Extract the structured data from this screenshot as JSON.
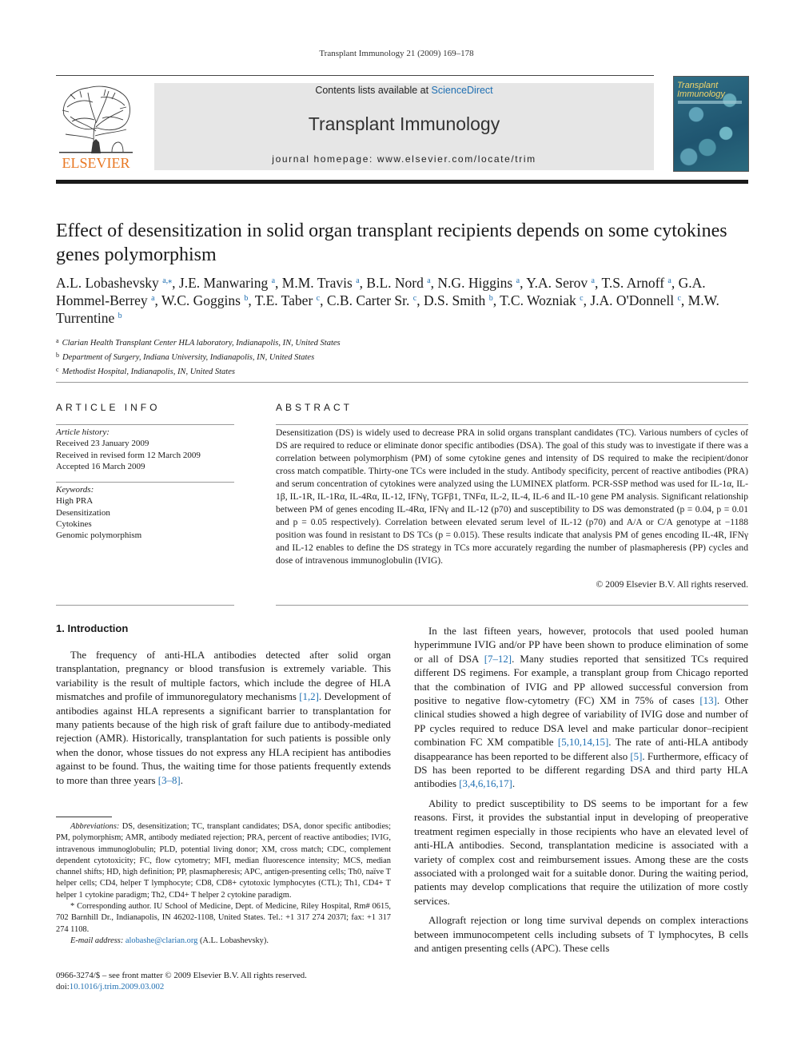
{
  "running_head": "Transplant Immunology 21 (2009) 169–178",
  "masthead": {
    "contents_prefix": "Contents lists available at ",
    "contents_link": "ScienceDirect",
    "journal_title": "Transplant Immunology",
    "homepage": "journal homepage: www.elsevier.com/locate/trim",
    "publisher_logo_text": "ELSEVIER",
    "cover_title": "Transplant Immunology",
    "brand_color": "#e87722",
    "link_color": "#1f6fb2"
  },
  "article": {
    "title": "Effect of desensitization in solid organ transplant recipients depends on some cytokines genes polymorphism",
    "authors": [
      {
        "name": "A.L. Lobashevsky",
        "aff": "a,⁎"
      },
      {
        "name": "J.E. Manwaring",
        "aff": "a"
      },
      {
        "name": "M.M. Travis",
        "aff": "a"
      },
      {
        "name": "B.L. Nord",
        "aff": "a"
      },
      {
        "name": "N.G. Higgins",
        "aff": "a"
      },
      {
        "name": "Y.A. Serov",
        "aff": "a"
      },
      {
        "name": "T.S. Arnoff",
        "aff": "a"
      },
      {
        "name": "G.A. Hommel-Berrey",
        "aff": "a"
      },
      {
        "name": "W.C. Goggins",
        "aff": "b"
      },
      {
        "name": "T.E. Taber",
        "aff": "c"
      },
      {
        "name": "C.B. Carter Sr.",
        "aff": "c"
      },
      {
        "name": "D.S. Smith",
        "aff": "b"
      },
      {
        "name": "T.C. Wozniak",
        "aff": "c"
      },
      {
        "name": "J.A. O'Donnell",
        "aff": "c"
      },
      {
        "name": "M.W. Turrentine",
        "aff": "b"
      }
    ],
    "affiliations": [
      {
        "label": "a",
        "text": "Clarian Health Transplant Center HLA laboratory, Indianapolis, IN, United States"
      },
      {
        "label": "b",
        "text": "Department of Surgery, Indiana University, Indianapolis, IN, United States"
      },
      {
        "label": "c",
        "text": "Methodist Hospital, Indianapolis, IN, United States"
      }
    ]
  },
  "article_info": {
    "heading": "ARTICLE INFO",
    "history_label": "Article history:",
    "history": [
      "Received 23 January 2009",
      "Received in revised form 12 March 2009",
      "Accepted 16 March 2009"
    ],
    "keywords_label": "Keywords:",
    "keywords": [
      "High PRA",
      "Desensitization",
      "Cytokines",
      "Genomic polymorphism"
    ]
  },
  "abstract": {
    "heading": "ABSTRACT",
    "text": "Desensitization (DS) is widely used to decrease PRA in solid organs transplant candidates (TC). Various numbers of cycles of DS are required to reduce or eliminate donor specific antibodies (DSA). The goal of this study was to investigate if there was a correlation between polymorphism (PM) of some cytokine genes and intensity of DS required to make the recipient/donor cross match compatible. Thirty-one TCs were included in the study. Antibody specificity, percent of reactive antibodies (PRA) and serum concentration of cytokines were analyzed using the LUMINEX platform. PCR-SSP method was used for IL-1α, IL-1β, IL-1R, IL-1Rα, IL-4Rα, IL-12, IFNγ, TGFβ1, TNFα, IL-2, IL-4, IL-6 and IL-10 gene PM analysis. Significant relationship between PM of genes encoding IL-4Rα, IFNγ and IL-12 (p70) and susceptibility to DS was demonstrated (p = 0.04, p = 0.01 and p = 0.05 respectively). Correlation between elevated serum level of IL-12 (p70) and A/A or C/A genotype at −1188 position was found in resistant to DS TCs (p = 0.015). These results indicate that analysis PM of genes encoding IL-4R, IFNγ and IL-12 enables to define the DS strategy in TCs more accurately regarding the number of plasmapheresis (PP) cycles and dose of intravenous immunoglobulin (IVIG).",
    "copyright": "© 2009 Elsevier B.V. All rights reserved."
  },
  "introduction": {
    "heading": "1. Introduction",
    "col1_paragraphs": [
      [
        {
          "t": "The frequency of anti-HLA antibodies detected after solid organ transplantation, pregnancy or blood transfusion is extremely variable. This variability is the result of multiple factors, which include the degree of HLA mismatches and profile of immunoregulatory mechanisms "
        },
        {
          "r": "[1,2]"
        },
        {
          "t": ". Development of antibodies against HLA represents a significant barrier to transplantation for many patients because of the high risk of graft failure due to antibody-mediated rejection (AMR). Historically, transplantation for such patients is possible only when the donor, whose tissues do not express any HLA recipient has antibodies against to be found. Thus, the waiting time for those patients frequently extends to more than three years "
        },
        {
          "r": "[3–8]"
        },
        {
          "t": "."
        }
      ]
    ],
    "col2_paragraphs": [
      [
        {
          "t": "In the last fifteen years, however, protocols that used pooled human hyperimmune IVIG and/or PP have been shown to produce elimination of some or all of DSA "
        },
        {
          "r": "[7–12]"
        },
        {
          "t": ". Many studies reported that sensitized TCs required different DS regimens. For example, a transplant group from Chicago reported that the combination of IVIG and PP allowed successful conversion from positive to negative flow-cytometry (FC) XM in 75% of cases "
        },
        {
          "r": "[13]"
        },
        {
          "t": ". Other clinical studies showed a high degree of variability of IVIG dose and number of PP cycles required to reduce DSA level and make particular donor–recipient combination FC XM compatible "
        },
        {
          "r": "[5,10,14,15]"
        },
        {
          "t": ". The rate of anti-HLA antibody disappearance has been reported to be different also "
        },
        {
          "r": "[5]"
        },
        {
          "t": ". Furthermore, efficacy of DS has been reported to be different regarding DSA and third party HLA antibodies "
        },
        {
          "r": "[3,4,6,16,17]"
        },
        {
          "t": "."
        }
      ],
      [
        {
          "t": "Ability to predict susceptibility to DS seems to be important for a few reasons. First, it provides the substantial input in developing of preoperative treatment regimen especially in those recipients who have an elevated level of anti-HLA antibodies. Second, transplantation medicine is associated with a variety of complex cost and reimbursement issues. Among these are the costs associated with a prolonged wait for a suitable donor. During the waiting period, patients may develop complications that require the utilization of more costly services."
        }
      ],
      [
        {
          "t": "Allograft rejection or long time survival depends on complex interactions between immunocompetent cells including subsets of T lymphocytes, B cells and antigen presenting cells (APC). These cells"
        }
      ]
    ]
  },
  "footnotes": {
    "abbreviations_label": "Abbreviations:",
    "abbreviations": "DS, desensitization; TC, transplant candidates; DSA, donor specific antibodies; PM, polymorphism; AMR, antibody mediated rejection; PRA, percent of reactive antibodies; IVIG, intravenous immunoglobulin; PLD, potential living donor; XM, cross match; CDC, complement dependent cytotoxicity; FC, flow cytometry; MFI, median fluorescence intensity; MCS, median channel shifts; HD, high definition; PP, plasmapheresis; APC, antigen-presenting cells; Th0, naïve T helper cells; CD4, helper T lymphocyte; CD8, CD8+ cytotoxic lymphocytes (CTL); Th1, CD4+ T helper 1 cytokine paradigm; Th2, CD4+ T helper 2 cytokine paradigm.",
    "corresponding": "* Corresponding author. IU School of Medicine, Dept. of Medicine, Riley Hospital, Rm# 0615, 702 Barnhill Dr., Indianapolis, IN 46202-1108, United States. Tel.: +1 317 274 2037l; fax: +1 317 274 1108.",
    "email_label": "E-mail address:",
    "email": "alobashe@clarian.org",
    "email_suffix": " (A.L. Lobashevsky)."
  },
  "footer": {
    "issn": "0966-3274/$ – see front matter © 2009 Elsevier B.V. All rights reserved.",
    "doi_label": "doi:",
    "doi": "10.1016/j.trim.2009.03.002"
  }
}
